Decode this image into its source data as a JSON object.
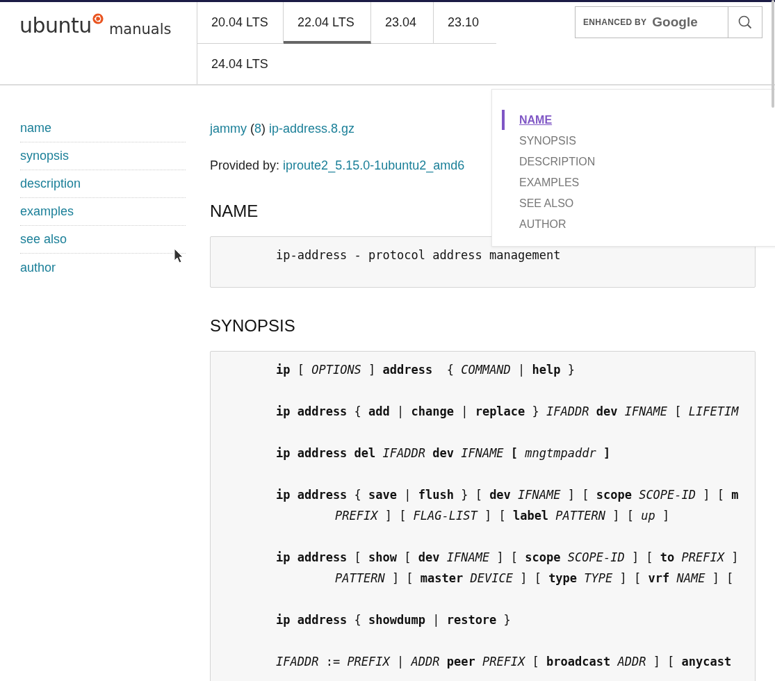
{
  "header": {
    "logo": {
      "word": "ubuntu",
      "suffix": "manuals"
    },
    "version_tabs": [
      {
        "label": "20.04 LTS",
        "selected": false
      },
      {
        "label": "22.04 LTS",
        "selected": true
      },
      {
        "label": "23.04",
        "selected": false
      },
      {
        "label": "23.10",
        "selected": false
      },
      {
        "label": "24.04 LTS",
        "selected": false
      }
    ],
    "search": {
      "brand_label": "ENHANCED BY",
      "brand_name": "Google"
    }
  },
  "sidebar": {
    "items": [
      "name",
      "synopsis",
      "description",
      "examples",
      "see also",
      "author"
    ]
  },
  "breadcrumb": {
    "release": "jammy",
    "section_open": "(",
    "section": "8",
    "section_close": ")",
    "file": "ip-address.8.gz"
  },
  "provided_by": {
    "label": "Provided by:",
    "package": "iproute2_5.15.0-1ubuntu2_amd6"
  },
  "sections": [
    {
      "heading": "NAME",
      "lines": [
        {
          "kind": "line",
          "text": "ip-address - protocol address management"
        }
      ]
    },
    {
      "heading": "SYNOPSIS",
      "lines": [
        {
          "kind": "line",
          "text": "**ip** [ *OPTIONS* ] **address**  { *COMMAND* | **help** }"
        },
        {
          "kind": "line",
          "text": "**ip address** { **add** | **change** | **replace** } *IFADDR* **dev** *IFNAME* [ *LIFETIM*"
        },
        {
          "kind": "line",
          "text": "**ip address del** *IFADDR* **dev** *IFNAME* **[** *mngtmpaddr* **]**"
        },
        {
          "kind": "line",
          "text": "**ip address** { **save** | **flush** } [ **dev** *IFNAME* ] [ **scope** *SCOPE-ID* ] [ **m**"
        },
        {
          "kind": "continuation",
          "text": "*PREFIX* ] [ *FLAG-LIST* ] [ **label** *PATTERN* ] [ *up* ]"
        },
        {
          "kind": "line",
          "text": "**ip address** [ **show** [ **dev** *IFNAME* ] [ **scope** *SCOPE-ID* ] [ **to** *PREFIX* ]"
        },
        {
          "kind": "continuation",
          "text": "*PATTERN* ] [ **master** *DEVICE* ] [ **type** *TYPE* ] [ **vrf** *NAME* ] ["
        },
        {
          "kind": "line",
          "text": "**ip address** { **showdump** | **restore** }"
        },
        {
          "kind": "line",
          "text": "*IFADDR* := *PREFIX* | *ADDR* **peer** *PREFIX* [ **broadcast** *ADDR* ] [ **anycast**"
        }
      ]
    }
  ],
  "toc": {
    "items": [
      {
        "label": "NAME",
        "selected": true
      },
      {
        "label": "SYNOPSIS",
        "selected": false
      },
      {
        "label": "DESCRIPTION",
        "selected": false
      },
      {
        "label": "EXAMPLES",
        "selected": false
      },
      {
        "label": "SEE ALSO",
        "selected": false
      },
      {
        "label": "AUTHOR",
        "selected": false
      }
    ]
  }
}
